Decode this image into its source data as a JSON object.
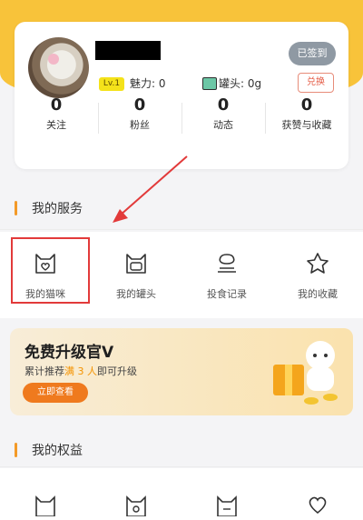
{
  "profile": {
    "signed_label": "已签到",
    "level": "Lv.1",
    "charm": "魅力: 0",
    "cans": "罐头: 0g",
    "exchange_label": "兑换",
    "stats": [
      {
        "value": "0",
        "label": "关注"
      },
      {
        "value": "0",
        "label": "粉丝"
      },
      {
        "value": "0",
        "label": "动态"
      },
      {
        "value": "0",
        "label": "获赞与收藏"
      }
    ]
  },
  "services": {
    "title": "我的服务",
    "items": [
      {
        "label": "我的猫咪",
        "icon": "cat-heart-icon"
      },
      {
        "label": "我的罐头",
        "icon": "cat-can-icon"
      },
      {
        "label": "投食记录",
        "icon": "feeding-record-icon"
      },
      {
        "label": "我的收藏",
        "icon": "star-icon"
      }
    ]
  },
  "promo": {
    "title": "免费升级官V",
    "subtitle_prefix": "累计推荐",
    "subtitle_highlight": "满 3 人",
    "subtitle_suffix": "即可升级",
    "button": "立即查看"
  },
  "rights": {
    "title": "我的权益",
    "items": [
      {
        "icon": "cat-icon"
      },
      {
        "icon": "cat-lock-icon"
      },
      {
        "icon": "cat-badge-icon"
      },
      {
        "icon": "heart-hand-icon"
      }
    ]
  },
  "colors": {
    "accent": "#f8c33a",
    "section_bar": "#f39a28",
    "highlight": "#e23a3a"
  }
}
